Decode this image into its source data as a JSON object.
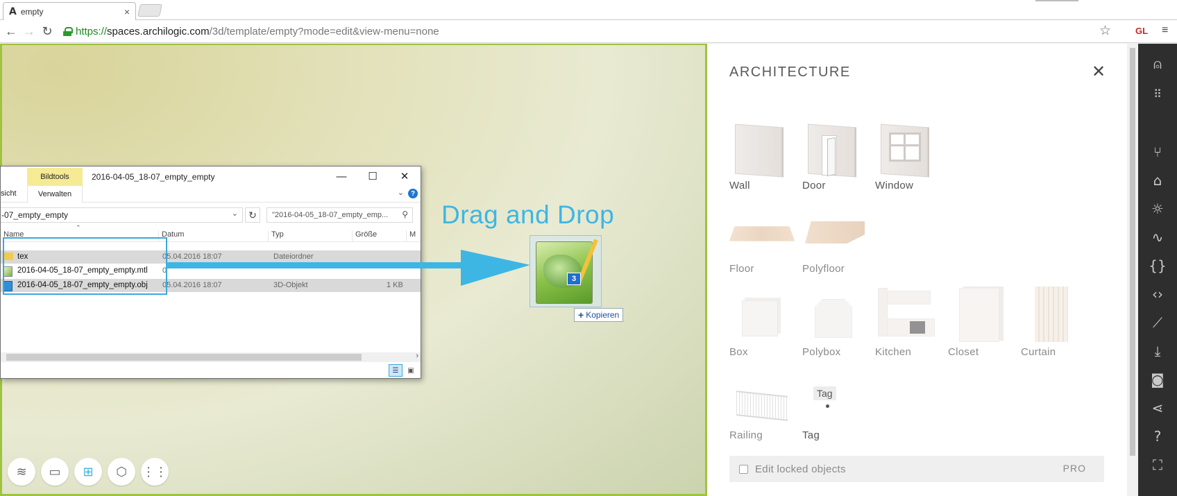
{
  "browser": {
    "tab_title": "empty",
    "tab_favicon": "A",
    "tab_close": "×",
    "url_scheme": "https://",
    "url_host": "spaces.archilogic.com",
    "url_path": "/3d/template/empty?mode=edit&view-menu=none",
    "extension_label": "GL",
    "icons": {
      "back": "←",
      "forward": "→",
      "reload": "↻",
      "star": "☆",
      "menu": "≡"
    }
  },
  "explorer": {
    "ribbon_tab_highlight": "Bildtools",
    "window_title": "2016-04-05_18-07_empty_empty",
    "tab_left_partial": "sicht",
    "tab_verwalten": "Verwalten",
    "address_path": "-07_empty_empty",
    "search_placeholder": "\"2016-04-05_18-07_empty_emp...",
    "columns": [
      "Name",
      "Datum",
      "Typ",
      "Größe",
      "M"
    ],
    "rows": [
      {
        "name": "tex",
        "date": "05.04.2016 18:07",
        "type": "Dateiordner",
        "size": "",
        "icon": "folder-icon"
      },
      {
        "name": "2016-04-05_18-07_empty_empty.mtl",
        "date": "0",
        "type": "",
        "size": "",
        "icon": "mtl-file-icon"
      },
      {
        "name": "2016-04-05_18-07_empty_empty.obj",
        "date": "05.04.2016 18:07",
        "type": "3D-Objekt",
        "size": "1 KB",
        "icon": "obj-file-icon"
      }
    ],
    "win_controls": {
      "minimize": "—",
      "maximize": "☐",
      "close": "✕"
    },
    "help_glyph": "?",
    "chevron_glyph": "⌄"
  },
  "annotation": {
    "drag_drop_label": "Drag and Drop",
    "drag_count": "3",
    "copy_tooltip": "Kopieren",
    "copy_plus": "+"
  },
  "panel": {
    "title": "ARCHITECTURE",
    "close_glyph": "✕",
    "items": [
      {
        "label": "Wall",
        "icon": "wall-thumbnail"
      },
      {
        "label": "Door",
        "icon": "door-thumbnail"
      },
      {
        "label": "Window",
        "icon": "window-thumbnail"
      },
      {
        "label": "Floor",
        "icon": "floor-thumbnail"
      },
      {
        "label": "Polyfloor",
        "icon": "polyfloor-thumbnail"
      },
      {
        "label": "Box",
        "icon": "box-thumbnail"
      },
      {
        "label": "Polybox",
        "icon": "polybox-thumbnail"
      },
      {
        "label": "Kitchen",
        "icon": "kitchen-thumbnail"
      },
      {
        "label": "Closet",
        "icon": "closet-thumbnail"
      },
      {
        "label": "Curtain",
        "icon": "curtain-thumbnail"
      },
      {
        "label": "Railing",
        "icon": "railing-thumbnail"
      },
      {
        "label": "Tag",
        "icon": "tag-thumbnail",
        "tag_text": "Tag"
      }
    ],
    "edit_locked_label": "Edit locked objects",
    "edit_locked_checked": false,
    "pro_label": "PRO"
  },
  "sidebar_icons": [
    "user-icon",
    "apps-grid-icon",
    "chair-icon",
    "home-icon",
    "light-icon",
    "pulse-icon",
    "braces-icon",
    "code-icon",
    "measure-icon",
    "download-icon",
    "camera-icon",
    "share-icon",
    "help-icon",
    "fullscreen-icon"
  ],
  "viewport_tools": [
    "floors-icon",
    "camera-icon",
    "floorplan-icon",
    "3d-box-icon",
    "walk-icon"
  ],
  "colors": {
    "accent_blue": "#3db6e3",
    "viewport_border": "#9ec33c",
    "sidebar_bg": "#2e2e2e"
  }
}
